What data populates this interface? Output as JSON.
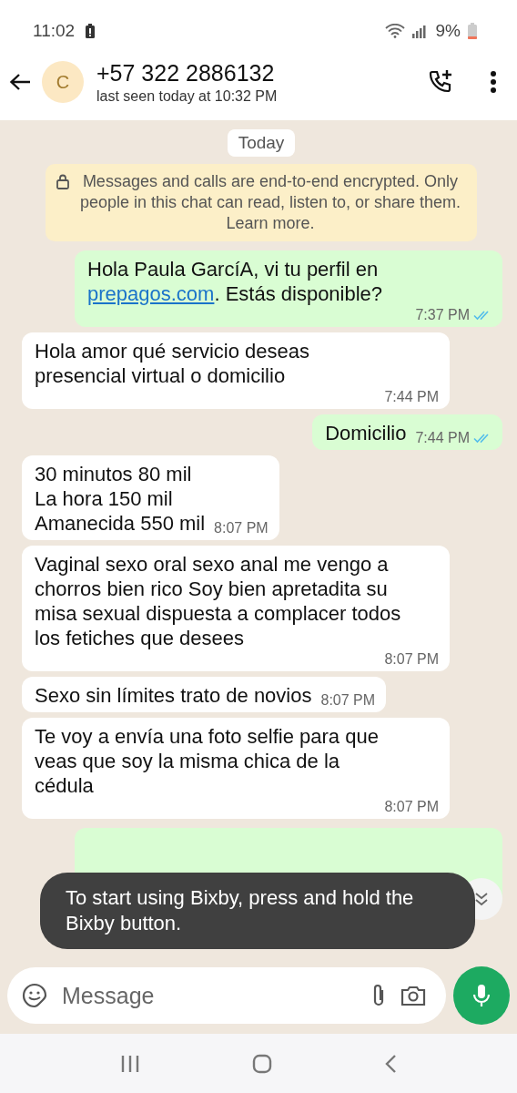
{
  "status_bar": {
    "time": "11:02",
    "battery": "9%"
  },
  "header": {
    "avatar_letter": "C",
    "name": "+57 322 2886132",
    "last_seen": "last seen today at 10:32 PM"
  },
  "date_chip": "Today",
  "encryption_notice": "Messages and calls are end-to-end encrypted. Only people in this chat can read, listen to, or share them. Learn more.",
  "messages": [
    {
      "kind": "out",
      "parts": [
        {
          "text": "Hola Paula GarcíA, vi tu perfil en "
        },
        {
          "text": "prepagos.com",
          "kind": "link"
        },
        {
          "text": ". Estás disponible?"
        }
      ],
      "time": "7:37 PM",
      "read": true
    },
    {
      "kind": "in",
      "parts": [
        {
          "text": "Hola amor qué servicio deseas presencial virtual o domicilio"
        }
      ],
      "time": "7:44 PM"
    },
    {
      "kind": "out",
      "parts": [
        {
          "text": "Domicilio"
        }
      ],
      "time": "7:44 PM",
      "read": true
    },
    {
      "kind": "in",
      "parts": [
        {
          "text": "30 minutos 80 mil\nLa hora 150 mil\nAmanecida 550 mil"
        }
      ],
      "time": "8:07 PM"
    },
    {
      "kind": "in",
      "parts": [
        {
          "text": "Vaginal sexo oral sexo anal me vengo a chorros bien rico Soy bien apretadita su misa sexual dispuesta a complacer todos los fetiches que desees"
        }
      ],
      "time": "8:07 PM"
    },
    {
      "kind": "in",
      "parts": [
        {
          "text": "Sexo sin límites trato de novios"
        }
      ],
      "time": "8:07 PM"
    },
    {
      "kind": "in",
      "parts": [
        {
          "text": "Te voy a envía una foto selfie para que veas que soy la misma chica de la cédula"
        }
      ],
      "time": "8:07 PM"
    },
    {
      "kind": "covered"
    }
  ],
  "toast": "To start using Bixby, press and hold the Bixby button.",
  "composer": {
    "placeholder": "Message"
  }
}
